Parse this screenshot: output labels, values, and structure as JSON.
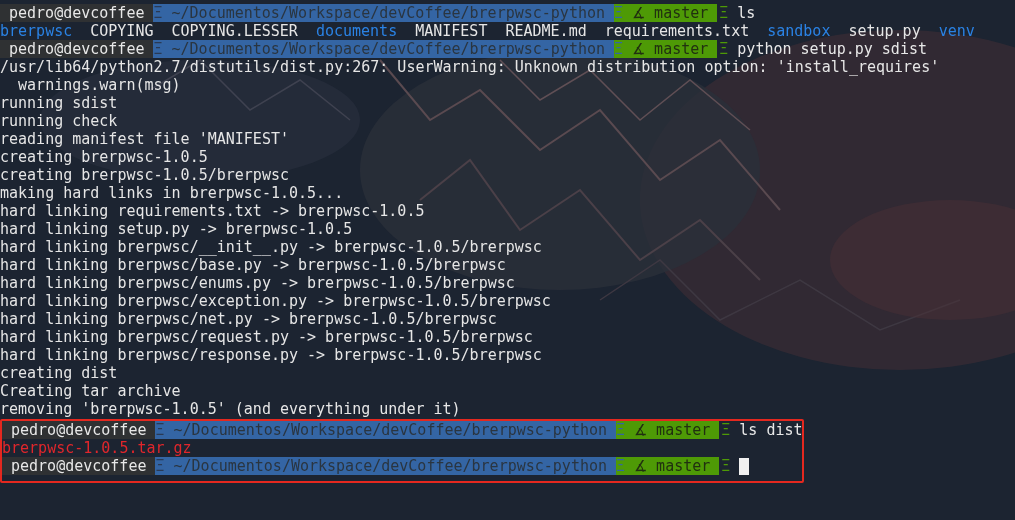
{
  "session": [
    {
      "kind": "prompt",
      "user": "pedro@devcoffee",
      "path_separator": "Ξ",
      "path": "~/Documentos/Workspace/devCoffee/brerpwsc-python",
      "branch_separator": "Ξ",
      "branch_icon": "∡",
      "branch": "master",
      "end_separator": "Ξ",
      "command": "ls"
    },
    {
      "kind": "files",
      "items": [
        {
          "name": "brerpwsc",
          "kind": "directory"
        },
        {
          "name": "COPYING",
          "kind": "file"
        },
        {
          "name": "COPYING.LESSER",
          "kind": "file"
        },
        {
          "name": "documents",
          "kind": "directory"
        },
        {
          "name": "MANIFEST",
          "kind": "file"
        },
        {
          "name": "README.md",
          "kind": "file"
        },
        {
          "name": "requirements.txt",
          "kind": "file"
        },
        {
          "name": "sandbox",
          "kind": "directory"
        },
        {
          "name": "setup.py",
          "kind": "file"
        },
        {
          "name": "venv",
          "kind": "directory"
        }
      ]
    },
    {
      "kind": "prompt",
      "user": "pedro@devcoffee",
      "path_separator": "Ξ",
      "path": "~/Documentos/Workspace/devCoffee/brerpwsc-python",
      "branch_separator": "Ξ",
      "branch_icon": "∡",
      "branch": "master",
      "end_separator": "Ξ",
      "command": "python setup.py sdist"
    },
    {
      "kind": "text",
      "text": "/usr/lib64/python2.7/distutils/dist.py:267: UserWarning: Unknown distribution option: 'install_requires'"
    },
    {
      "kind": "text",
      "text": "  warnings.warn(msg)"
    },
    {
      "kind": "text",
      "text": "running sdist"
    },
    {
      "kind": "text",
      "text": "running check"
    },
    {
      "kind": "text",
      "text": "reading manifest file 'MANIFEST'"
    },
    {
      "kind": "text",
      "text": "creating brerpwsc-1.0.5"
    },
    {
      "kind": "text",
      "text": "creating brerpwsc-1.0.5/brerpwsc"
    },
    {
      "kind": "text",
      "text": "making hard links in brerpwsc-1.0.5..."
    },
    {
      "kind": "text",
      "text": "hard linking requirements.txt -> brerpwsc-1.0.5"
    },
    {
      "kind": "text",
      "text": "hard linking setup.py -> brerpwsc-1.0.5"
    },
    {
      "kind": "text",
      "text": "hard linking brerpwsc/__init__.py -> brerpwsc-1.0.5/brerpwsc"
    },
    {
      "kind": "text",
      "text": "hard linking brerpwsc/base.py -> brerpwsc-1.0.5/brerpwsc"
    },
    {
      "kind": "text",
      "text": "hard linking brerpwsc/enums.py -> brerpwsc-1.0.5/brerpwsc"
    },
    {
      "kind": "text",
      "text": "hard linking brerpwsc/exception.py -> brerpwsc-1.0.5/brerpwsc"
    },
    {
      "kind": "text",
      "text": "hard linking brerpwsc/net.py -> brerpwsc-1.0.5/brerpwsc"
    },
    {
      "kind": "text",
      "text": "hard linking brerpwsc/request.py -> brerpwsc-1.0.5/brerpwsc"
    },
    {
      "kind": "text",
      "text": "hard linking brerpwsc/response.py -> brerpwsc-1.0.5/brerpwsc"
    },
    {
      "kind": "text",
      "text": "creating dist"
    },
    {
      "kind": "text",
      "text": "Creating tar archive"
    },
    {
      "kind": "text",
      "text": "removing 'brerpwsc-1.0.5' (and everything under it)"
    }
  ],
  "highlighted_block": [
    {
      "kind": "prompt",
      "user": "pedro@devcoffee",
      "path_separator": "Ξ",
      "path": "~/Documentos/Workspace/devCoffee/brerpwsc-python",
      "branch_separator": "Ξ",
      "branch_icon": "∡",
      "branch": "master",
      "end_separator": "Ξ",
      "command": "ls dist"
    },
    {
      "kind": "files",
      "items": [
        {
          "name": "brerpwsc-1.0.5.tar.gz",
          "kind": "archive"
        }
      ]
    },
    {
      "kind": "prompt",
      "user": "pedro@devcoffee",
      "path_separator": "Ξ",
      "path": "~/Documentos/Workspace/devCoffee/brerpwsc-python",
      "branch_separator": "Ξ",
      "branch_icon": "∡",
      "branch": "master",
      "end_separator": "Ξ",
      "cursor": true
    }
  ]
}
